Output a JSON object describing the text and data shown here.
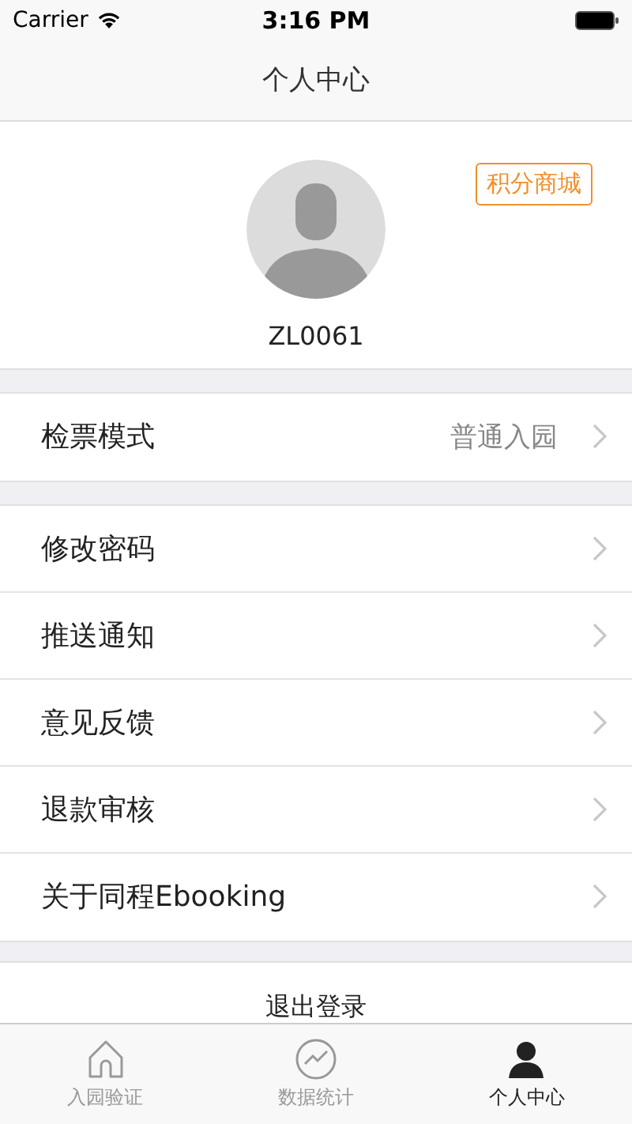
{
  "status_bar": {
    "carrier": "Carrier",
    "time": "3:16 PM"
  },
  "nav": {
    "title": "个人中心"
  },
  "profile": {
    "username": "ZL0061",
    "points_button": "积分商城"
  },
  "menu_groups": [
    [
      {
        "label": "检票模式",
        "value": "普通入园"
      }
    ],
    [
      {
        "label": "修改密码"
      },
      {
        "label": "推送通知"
      },
      {
        "label": "意见反馈"
      },
      {
        "label": "退款审核"
      },
      {
        "label": "关于同程Ebooking"
      }
    ]
  ],
  "logout": "退出登录",
  "tabs": [
    {
      "kind": "home",
      "label": "入园验证",
      "selected": false
    },
    {
      "kind": "stats",
      "label": "数据统计",
      "selected": false
    },
    {
      "kind": "person",
      "label": "个人中心",
      "selected": true
    }
  ]
}
